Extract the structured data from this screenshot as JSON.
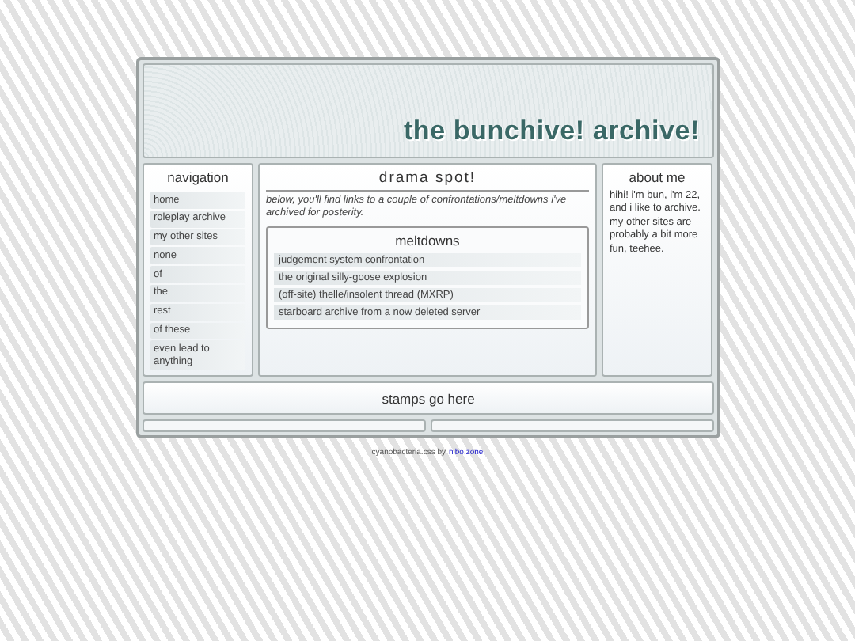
{
  "header": {
    "title": "the bunchive! archive!"
  },
  "navigation": {
    "title": "navigation",
    "items": [
      {
        "label": "home"
      },
      {
        "label": "roleplay archive"
      },
      {
        "label": "my other sites"
      },
      {
        "label": "none"
      },
      {
        "label": "of"
      },
      {
        "label": "the"
      },
      {
        "label": "rest"
      },
      {
        "label": "of these"
      },
      {
        "label": "even lead to anything"
      }
    ]
  },
  "main": {
    "title": "drama spot!",
    "intro": "below, you'll find links to a couple of confrontations/meltdowns i've archived for posterity.",
    "section": {
      "title": "meltdowns",
      "links": [
        {
          "label": "judgement system confrontation"
        },
        {
          "label": "the original silly-goose explosion"
        },
        {
          "label": "(off-site) thelle/insolent thread (MXRP)"
        },
        {
          "label": "starboard archive from a now deleted server"
        }
      ]
    }
  },
  "about": {
    "title": "about me",
    "text": "hihi! i'm bun, i'm 22, and i like to archive. my other sites are probably a bit more fun, teehee."
  },
  "stamps": {
    "text": "stamps go here"
  },
  "footer": {
    "text": "cyanobacteria.css by",
    "link": "nibo.zone"
  }
}
